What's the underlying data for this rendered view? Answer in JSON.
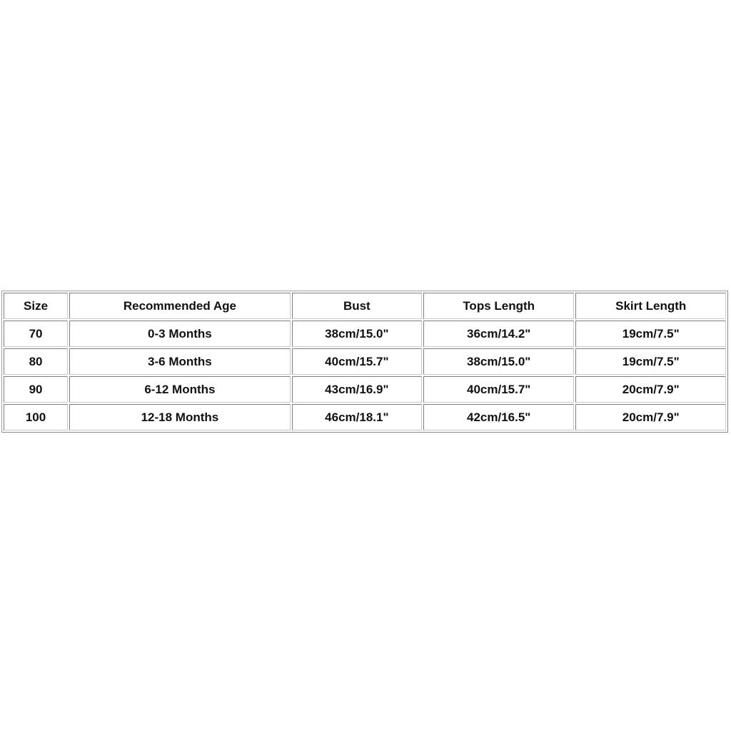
{
  "table": {
    "headers": [
      "Size",
      "Recommended Age",
      "Bust",
      "Tops Length",
      "Skirt Length"
    ],
    "rows": [
      [
        "70",
        "0-3 Months",
        "38cm/15.0\"",
        "36cm/14.2\"",
        "19cm/7.5\""
      ],
      [
        "80",
        "3-6 Months",
        "40cm/15.7\"",
        "38cm/15.0\"",
        "19cm/7.5\""
      ],
      [
        "90",
        "6-12 Months",
        "43cm/16.9\"",
        "40cm/15.7\"",
        "20cm/7.9\""
      ],
      [
        "100",
        "12-18 Months",
        "46cm/18.1\"",
        "42cm/16.5\"",
        "20cm/7.9\""
      ]
    ]
  }
}
